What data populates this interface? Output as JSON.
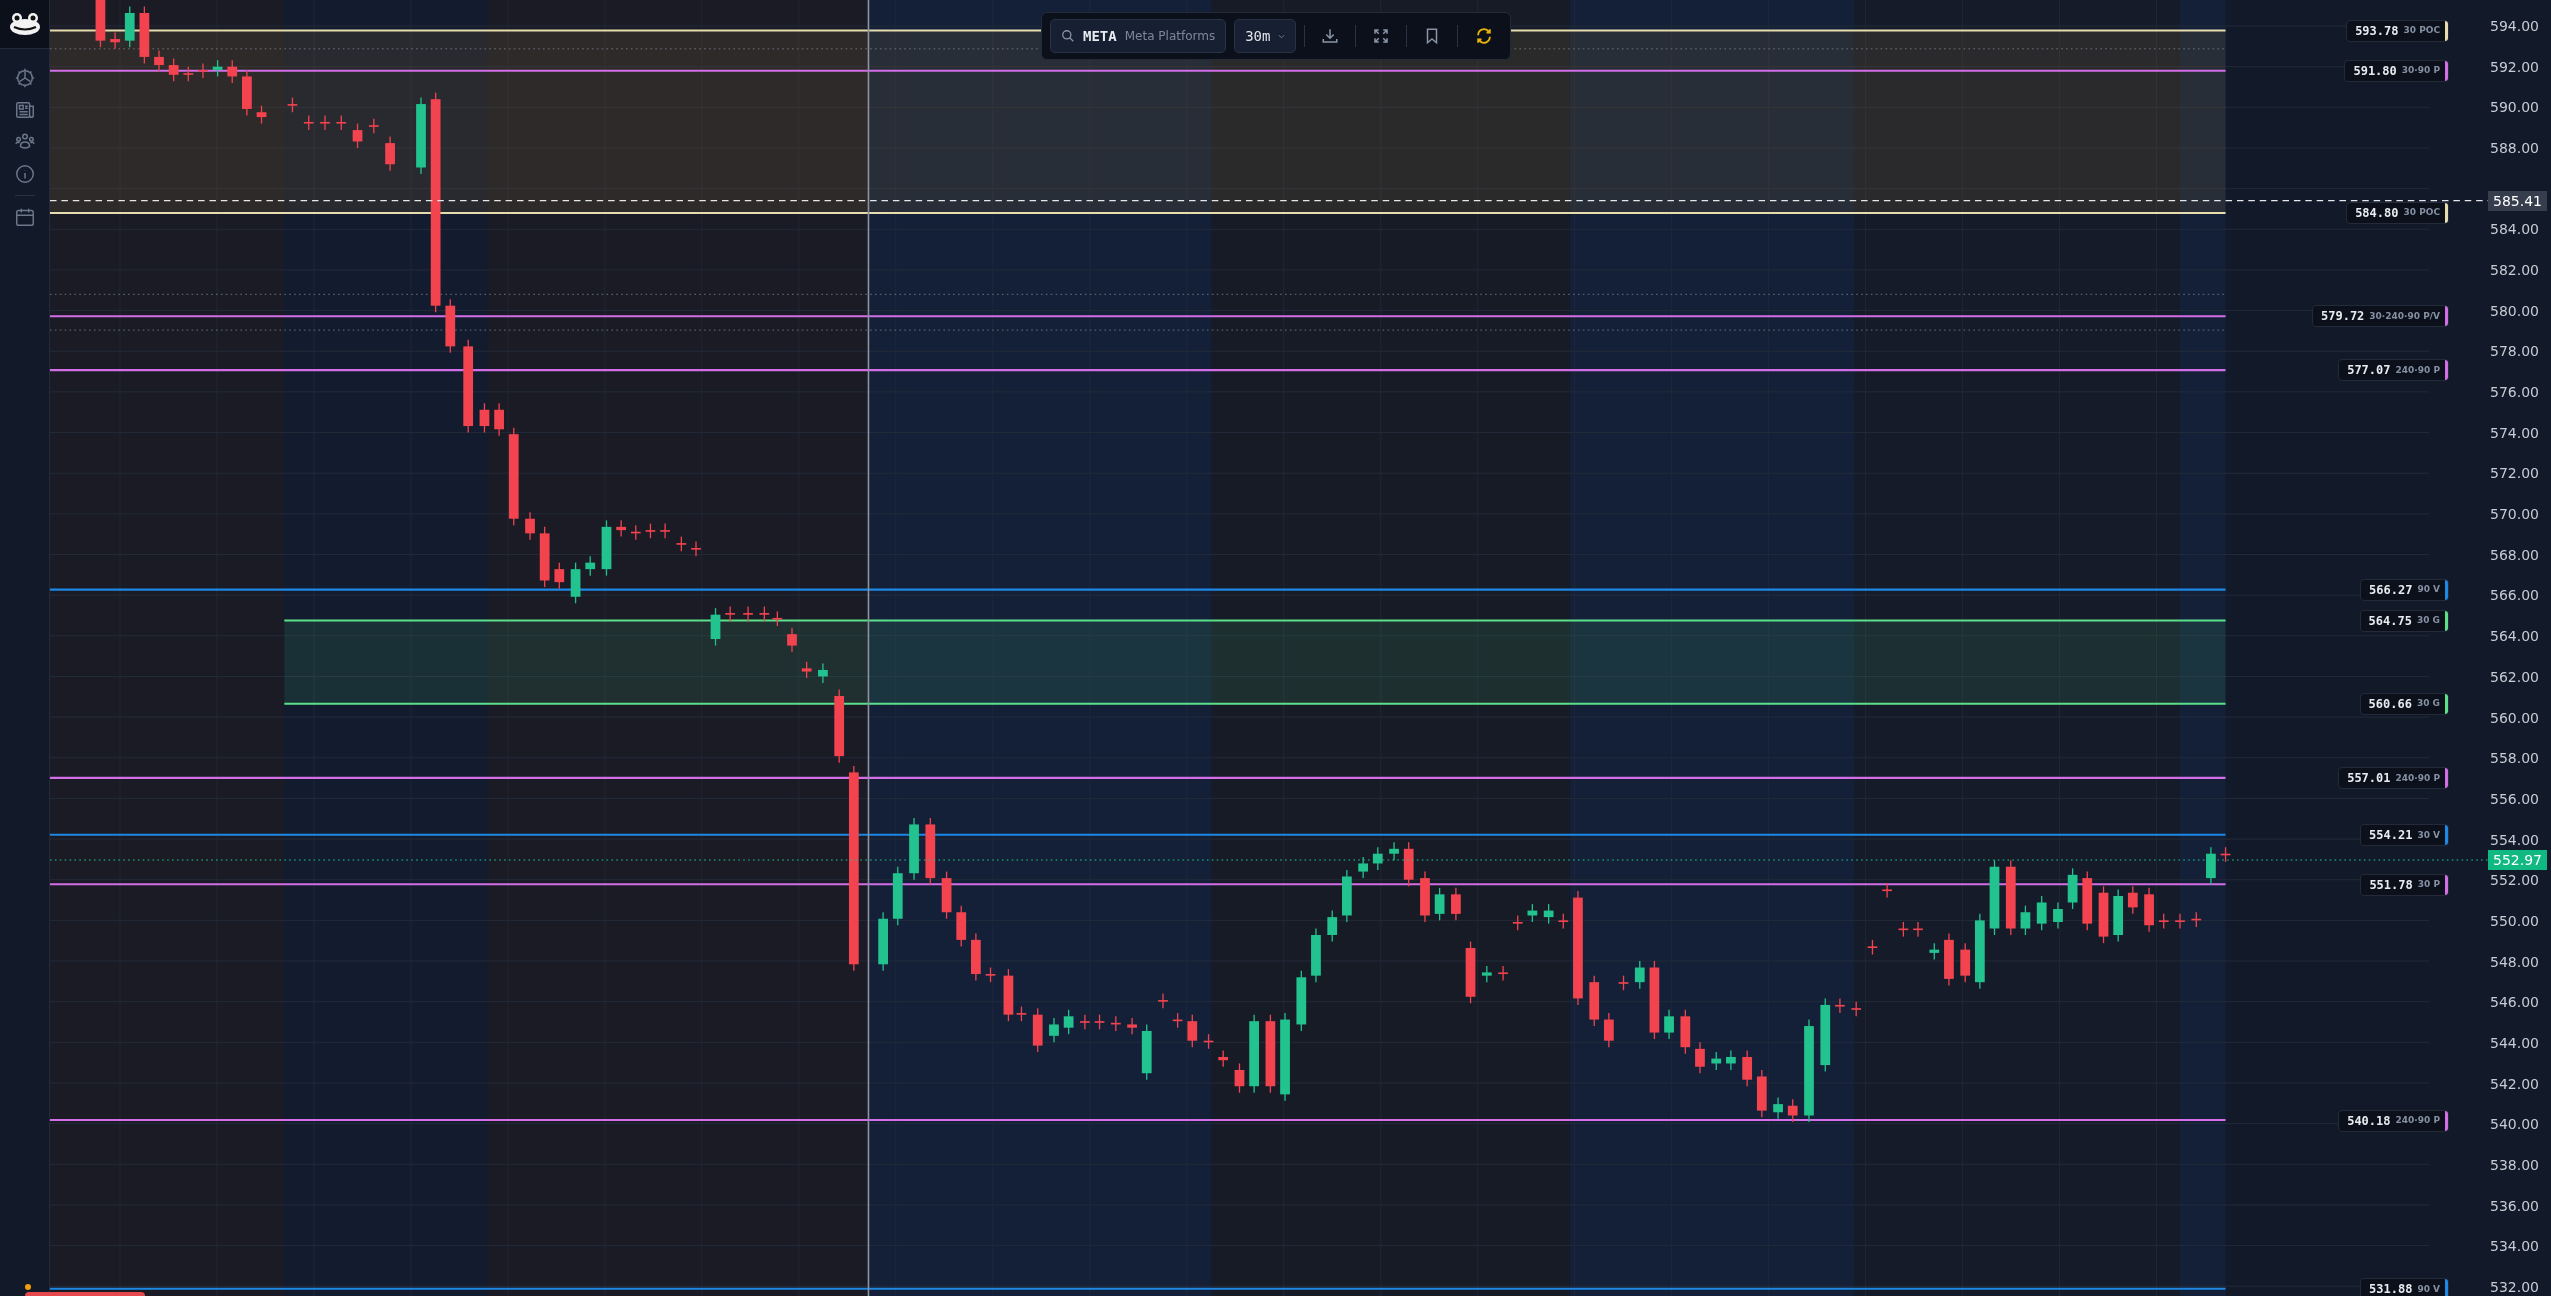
{
  "toolbar": {
    "symbol": "META",
    "company": "Meta Platforms",
    "interval": "30m"
  },
  "chart": {
    "price_axis": [
      "594.00",
      "592.00",
      "590.00",
      "588.00",
      "584.00",
      "582.00",
      "580.00",
      "578.00",
      "576.00",
      "574.00",
      "572.00",
      "570.00",
      "568.00",
      "566.00",
      "564.00",
      "562.00",
      "560.00",
      "558.00",
      "556.00",
      "554.00",
      "552.00",
      "550.00",
      "548.00",
      "546.00",
      "544.00",
      "542.00",
      "540.00",
      "538.00",
      "536.00",
      "534.00",
      "532.00"
    ],
    "crosshair_price": "585.41",
    "last_price": "552.97",
    "levels": [
      {
        "price": "593.78",
        "tag": "30 POC",
        "color": "#e6dcae"
      },
      {
        "price": "591.80",
        "tag": "30·90 P",
        "color": "#d36ee6"
      },
      {
        "price": "584.80",
        "tag": "30 POC",
        "color": "#e6dcae"
      },
      {
        "price": "579.72",
        "tag": "30·240·90 P/V",
        "color": "#d36ee6"
      },
      {
        "price": "577.07",
        "tag": "240·90 P",
        "color": "#d36ee6"
      },
      {
        "price": "566.27",
        "tag": "90 V",
        "color": "#1e88e5"
      },
      {
        "price": "564.75",
        "tag": "30 G",
        "color": "#5de08a"
      },
      {
        "price": "560.66",
        "tag": "30 G",
        "color": "#5de08a"
      },
      {
        "price": "557.01",
        "tag": "240·90 P",
        "color": "#d36ee6"
      },
      {
        "price": "554.21",
        "tag": "30 V",
        "color": "#1e88e5"
      },
      {
        "price": "551.78",
        "tag": "30 P",
        "color": "#d36ee6"
      },
      {
        "price": "540.18",
        "tag": "240·90 P",
        "color": "#d36ee6"
      },
      {
        "price": "531.88",
        "tag": "90 V",
        "color": "#1e88e5"
      }
    ]
  }
}
